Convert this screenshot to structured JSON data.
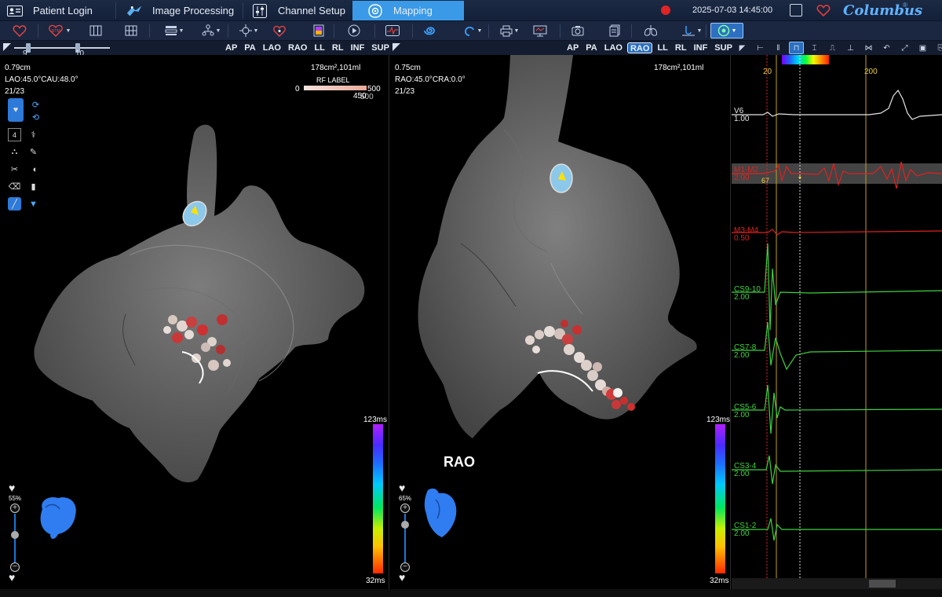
{
  "topbar": {
    "tabs": [
      {
        "label": "Patient Login",
        "icon": "patient-card-icon"
      },
      {
        "label": "Image Processing",
        "icon": "image-processing-icon"
      },
      {
        "label": "Channel Setup",
        "icon": "channel-sliders-icon"
      },
      {
        "label": "Mapping",
        "icon": "mapping-target-icon",
        "active": true
      }
    ],
    "datetime": "2025-07-03 14:45:00",
    "brand": "Columbus",
    "brand_mark": "®",
    "accent_color": "#3a9ae8",
    "record_color": "#e02424"
  },
  "viewstrip": {
    "slider_min_label": "9",
    "slider_max_label": "10",
    "left_views": [
      "AP",
      "PA",
      "LAO",
      "RAO",
      "LL",
      "RL",
      "INF",
      "SUP"
    ],
    "right_views": [
      "AP",
      "PA",
      "LAO",
      "RAO",
      "LL",
      "RL",
      "INF",
      "SUP"
    ],
    "right_selected": "RAO"
  },
  "left_pane": {
    "resolution": "0.79cm",
    "angle": "LAO:45.0°CAU:48.0°",
    "counter": "21/23",
    "area_volume": "178cm²,101ml",
    "rf_label_title": "RF LABEL",
    "rf_min": "0",
    "rf_max": "500",
    "rf_value": "450",
    "rf_value_over": "500",
    "scale_max": "123ms",
    "scale_min": "32ms",
    "zoom_percent": "55%",
    "zoom_plus": "+",
    "zoom_minus": "−",
    "tool_number": "4"
  },
  "right_pane": {
    "resolution": "0.75cm",
    "angle": "RAO:45.0°CRA:0.0°",
    "counter": "21/23",
    "area_volume": "178cm²,101ml",
    "view_label": "RAO",
    "scale_max": "123ms",
    "scale_min": "32ms",
    "zoom_percent": "65%",
    "zoom_plus": "+",
    "zoom_minus": "−"
  },
  "ecg": {
    "marker_left": "20",
    "marker_right": "200",
    "lat_value": "67",
    "channels": [
      {
        "name": "V6",
        "gain": "1.00",
        "color": "#e6e6e6"
      },
      {
        "name": "M1-M2",
        "gain": "2.00",
        "color": "#e02020",
        "highlighted": true
      },
      {
        "name": "M3-M4",
        "gain": "0.50",
        "color": "#e02020"
      },
      {
        "name": "CS9-10",
        "gain": "2.00",
        "color": "#3fd23f"
      },
      {
        "name": "CS7-8",
        "gain": "2.00",
        "color": "#3fd23f"
      },
      {
        "name": "CS5-6",
        "gain": "2.00",
        "color": "#3fd23f"
      },
      {
        "name": "CS3-4",
        "gain": "2.00",
        "color": "#3fd23f"
      },
      {
        "name": "CS1-2",
        "gain": "2.00",
        "color": "#3fd23f"
      }
    ]
  }
}
